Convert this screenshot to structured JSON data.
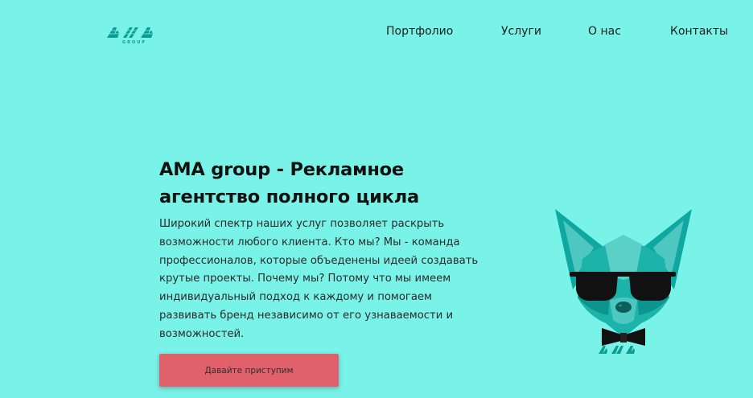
{
  "brand": {
    "logo_text": "AMA",
    "logo_subtext": "GROUP"
  },
  "nav": {
    "items": [
      {
        "label": "Портфолио"
      },
      {
        "label": "Услуги"
      },
      {
        "label": "О нас"
      },
      {
        "label": "Контакты"
      }
    ]
  },
  "hero": {
    "title": "AMA group - Рекламное агентство полного цикла",
    "description": "Широкий спектр наших услуг позволяет раскрыть возможности любого клиента. Кто мы? Мы - команда профессионалов, которые объеденены идеей создавать крутые проекты. Почему мы? Потому что мы имеем индивидуальный подход к каждому и помогаем развивать бренд независимо от его узнаваемости и возможностей.",
    "cta_label": "Давайте приступим"
  },
  "illustration": {
    "badge_text": "AMA"
  },
  "colors": {
    "background": "#79f2e7",
    "accent": "#0fa8a0",
    "button": "#e0606b"
  }
}
